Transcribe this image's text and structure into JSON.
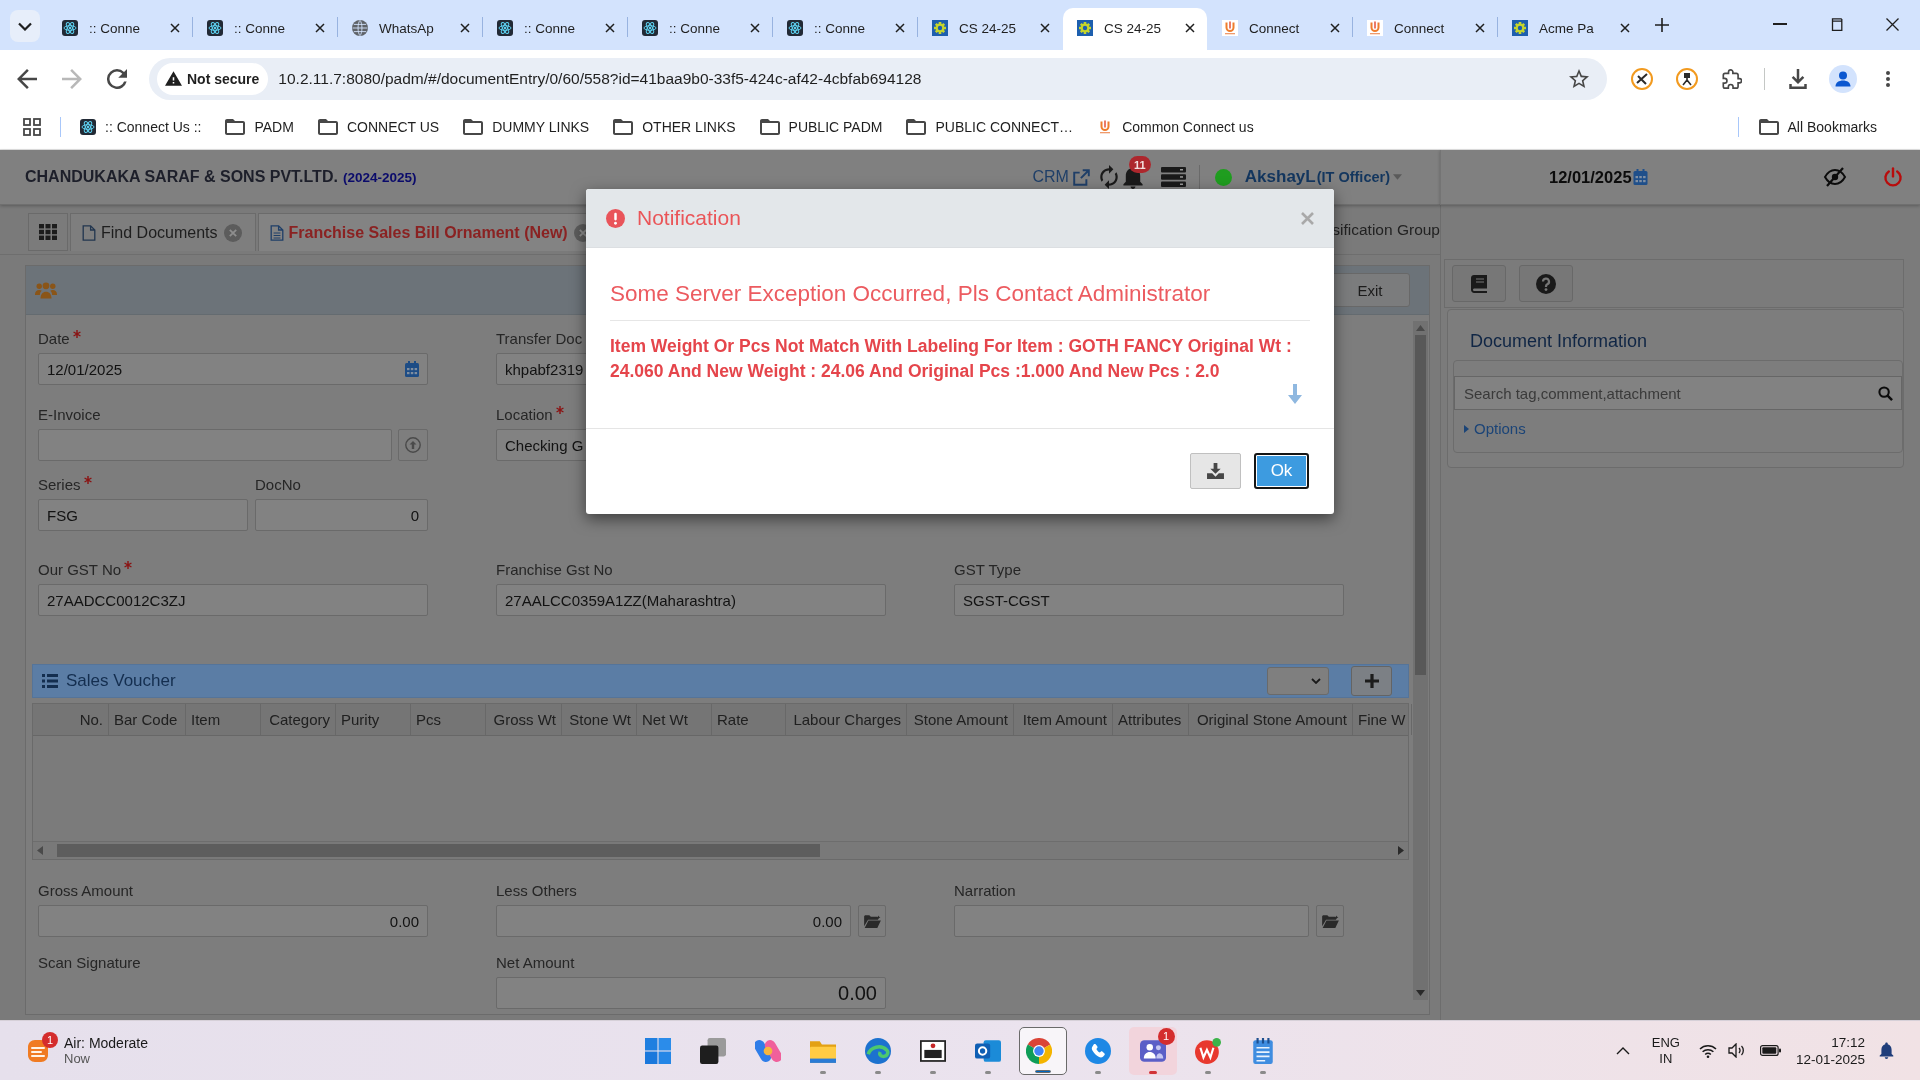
{
  "browser": {
    "tabs": [
      {
        "title": ":: Conne",
        "kind": "atom",
        "selected": false
      },
      {
        "title": ":: Conne",
        "kind": "atom",
        "selected": false
      },
      {
        "title": "WhatsAp",
        "kind": "globe",
        "selected": false
      },
      {
        "title": ":: Conne",
        "kind": "atom",
        "selected": false
      },
      {
        "title": ":: Conne",
        "kind": "atom",
        "selected": false
      },
      {
        "title": ":: Conne",
        "kind": "atom",
        "selected": false
      },
      {
        "title": "CS 24-25",
        "kind": "gear",
        "selected": false
      },
      {
        "title": "CS 24-25",
        "kind": "gear",
        "selected": true
      },
      {
        "title": "Connect",
        "kind": "logo",
        "selected": false
      },
      {
        "title": "Connect",
        "kind": "logo",
        "selected": false
      },
      {
        "title": "Acme Pa",
        "kind": "gear",
        "selected": false
      }
    ],
    "nav": [
      {
        "kind": "back",
        "disabled": false
      },
      {
        "kind": "forward",
        "disabled": true
      },
      {
        "kind": "reload",
        "disabled": false
      }
    ],
    "address": {
      "security": "Not secure",
      "url": "10.2.11.7:8080/padm/#/documentEntry/0/60/558?id=41baa9b0-33f5-424c-af42-4cbfab694128"
    },
    "bookmarks": [
      {
        "label": ":: Connect Us ::",
        "kind": "atom"
      },
      {
        "label": "PADM",
        "kind": "folder"
      },
      {
        "label": "CONNECT US",
        "kind": "folder"
      },
      {
        "label": "DUMMY LINKS",
        "kind": "folder"
      },
      {
        "label": "OTHER LINKS",
        "kind": "folder"
      },
      {
        "label": "PUBLIC PADM",
        "kind": "folder"
      },
      {
        "label": "PUBLIC CONNECT…",
        "kind": "folder"
      },
      {
        "label": "Common Connect us",
        "kind": "logo"
      }
    ],
    "all_bookmarks": "All Bookmarks"
  },
  "app": {
    "header": {
      "company": "CHANDUKAKA SARAF & SONS PVT.LTD.",
      "year": "(2024-2025)",
      "crm": "CRM",
      "notification_count": "11",
      "user": {
        "name": "AkshayL",
        "role": "(IT Officer)",
        "online": true
      },
      "date": "12/01/2025"
    },
    "tabs": [
      {
        "label": "Find Documents",
        "selected": false
      },
      {
        "label": "Franchise Sales Bill Ornament (New)",
        "selected": true
      }
    ],
    "covered_tab": "sification Group",
    "exit": "Exit",
    "form": {
      "rows": [
        [
          {
            "kind": "date",
            "label": "Date",
            "required": true,
            "value": "12/01/2025"
          },
          {
            "kind": "text",
            "label": "Transfer Doc",
            "required": false,
            "value": "khpabf2319"
          }
        ],
        [
          {
            "kind": "upload",
            "label": "E-Invoice",
            "required": false
          },
          {
            "kind": "text",
            "label": "Location",
            "required": true,
            "value": "Checking G"
          }
        ],
        [
          {
            "kind": "pair",
            "fields": [
              {
                "kind": "text",
                "label": "Series",
                "required": true,
                "value": "FSG"
              },
              {
                "kind": "number",
                "label": "DocNo",
                "required": false,
                "value": "0"
              }
            ]
          }
        ],
        [
          {
            "kind": "text",
            "label": "Our GST No",
            "required": true,
            "value": "27AADCC0012C3ZJ"
          },
          {
            "kind": "text",
            "label": "Franchise Gst No",
            "required": false,
            "value": "27AALCC0359A1ZZ(Maharashtra)"
          },
          {
            "kind": "text",
            "label": "GST Type",
            "required": false,
            "value": "SGST-CGST"
          }
        ]
      ]
    },
    "sales_voucher": {
      "title": "Sales Voucher",
      "columns": [
        "No.",
        "Bar Code",
        "Item",
        "Category",
        "Purity",
        "Pcs",
        "Gross Wt",
        "Stone Wt",
        "Net Wt",
        "Rate",
        "Labour Charges",
        "Stone Amount",
        "Item Amount",
        "Attributes",
        "Original Stone Amount",
        "Fine W"
      ]
    },
    "totals": {
      "rows": [
        [
          {
            "kind": "number",
            "label": "Gross Amount",
            "value": "0.00"
          },
          {
            "kind": "action",
            "label": "Less Others",
            "value": "0.00"
          },
          {
            "kind": "action",
            "label": "Narration"
          }
        ],
        [
          {
            "kind": "label",
            "label": "Scan Signature"
          },
          {
            "kind": "total",
            "label": "Net Amount",
            "value": "0.00"
          }
        ]
      ]
    },
    "side_panel": {
      "title": "Document Information",
      "search": {
        "placeholder": "Search tag,comment,attachment"
      },
      "options": {
        "label": "Options",
        "expanded": false
      }
    }
  },
  "dialog": {
    "title": "Notification",
    "heading": "Some Server Exception Occurred, Pls Contact Administrator",
    "message": "Item Weight Or Pcs Not Match With Labeling For Item : GOTH FANCY Original Wt : 24.060 And New Weight : 24.06 And Original Pcs :1.000 And New Pcs : 2.0",
    "ok": "Ok"
  },
  "taskbar": {
    "weather": {
      "title": "Air: Moderate",
      "subtitle": "Now",
      "badge": "1"
    },
    "apps": [
      {
        "kind": "start",
        "running": false,
        "selected": false,
        "attention": false
      },
      {
        "kind": "taskview",
        "running": false,
        "selected": false,
        "attention": false
      },
      {
        "kind": "assistant",
        "running": false,
        "selected": false,
        "attention": false
      },
      {
        "kind": "files",
        "running": true,
        "selected": false,
        "attention": false
      },
      {
        "kind": "wave",
        "running": true,
        "selected": false,
        "attention": false
      },
      {
        "kind": "viewer",
        "running": true,
        "selected": false,
        "attention": false
      },
      {
        "kind": "mail",
        "running": true,
        "selected": false,
        "attention": false
      },
      {
        "kind": "browser",
        "running": true,
        "selected": true,
        "attention": false
      },
      {
        "kind": "phone",
        "running": true,
        "selected": false,
        "attention": false
      },
      {
        "kind": "chat",
        "running": true,
        "selected": false,
        "attention": true,
        "badge": "1"
      },
      {
        "kind": "office",
        "running": true,
        "selected": false,
        "attention": false
      },
      {
        "kind": "notes",
        "running": true,
        "selected": false,
        "attention": false
      }
    ],
    "language": {
      "code": "ENG",
      "region": "IN"
    },
    "clock": {
      "time": "17:12",
      "date": "12-01-2025"
    }
  }
}
